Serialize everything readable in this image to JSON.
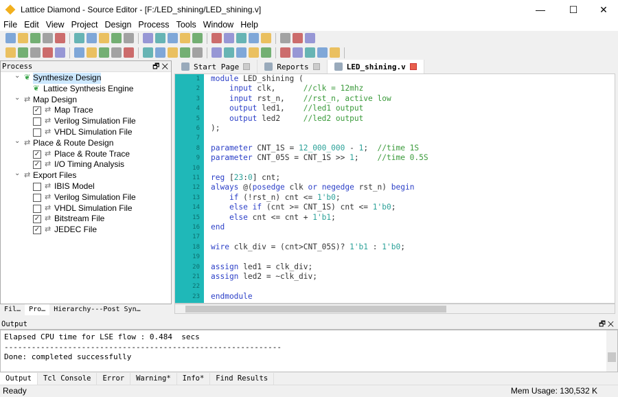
{
  "window": {
    "title": "Lattice Diamond - Source Editor - [F:/LED_shining/LED_shining.v]",
    "minimize": "—",
    "maximize": "☐",
    "close": "✕"
  },
  "menu": [
    "File",
    "Edit",
    "View",
    "Project",
    "Design",
    "Process",
    "Tools",
    "Window",
    "Help"
  ],
  "process_panel": {
    "title": "Process",
    "controls": "🗗 ✕",
    "items": [
      {
        "label": "Synthesize Design",
        "level": 0,
        "expand": true,
        "icon": "synthesis-icon",
        "selected": true
      },
      {
        "label": "Lattice Synthesis Engine",
        "level": 1,
        "icon": "synthesis-icon"
      },
      {
        "label": "Map Design",
        "level": 0,
        "expand": true,
        "icon": "process-icon"
      },
      {
        "label": "Map Trace",
        "level": 1,
        "checked": true,
        "icon": "process-icon"
      },
      {
        "label": "Verilog Simulation File",
        "level": 1,
        "checked": false,
        "icon": "process-icon"
      },
      {
        "label": "VHDL Simulation File",
        "level": 1,
        "checked": false,
        "icon": "process-icon"
      },
      {
        "label": "Place & Route Design",
        "level": 0,
        "expand": true,
        "icon": "process-icon"
      },
      {
        "label": "Place & Route Trace",
        "level": 1,
        "checked": true,
        "icon": "process-icon"
      },
      {
        "label": "I/O Timing Analysis",
        "level": 1,
        "checked": true,
        "icon": "process-icon"
      },
      {
        "label": "Export Files",
        "level": 0,
        "expand": true,
        "icon": "process-icon"
      },
      {
        "label": "IBIS Model",
        "level": 1,
        "checked": false,
        "icon": "process-icon"
      },
      {
        "label": "Verilog Simulation File",
        "level": 1,
        "checked": false,
        "icon": "process-icon"
      },
      {
        "label": "VHDL Simulation File",
        "level": 1,
        "checked": false,
        "icon": "process-icon"
      },
      {
        "label": "Bitstream File",
        "level": 1,
        "checked": true,
        "icon": "process-icon"
      },
      {
        "label": "JEDEC File",
        "level": 1,
        "checked": true,
        "icon": "process-icon"
      }
    ],
    "tabs": [
      {
        "label": "Fil…"
      },
      {
        "label": "Pro…",
        "active": true
      },
      {
        "label": "Hierarchy---Post Syn…"
      }
    ]
  },
  "editor": {
    "tabs": [
      {
        "label": "Start Page"
      },
      {
        "label": "Reports"
      },
      {
        "label": "LED_shining.v",
        "active": true
      }
    ],
    "gutter_color": "#1fb8b8",
    "lines": [
      [
        [
          "k",
          "module"
        ],
        [
          "p",
          " LED_shining ("
        ]
      ],
      [
        [
          "p",
          "    "
        ],
        [
          "k",
          "input"
        ],
        [
          "p",
          " clk,      "
        ],
        [
          "c",
          "//clk = 12mhz"
        ]
      ],
      [
        [
          "p",
          "    "
        ],
        [
          "k",
          "input"
        ],
        [
          "p",
          " rst_n,    "
        ],
        [
          "c",
          "//rst_n, active low"
        ]
      ],
      [
        [
          "p",
          "    "
        ],
        [
          "k",
          "output"
        ],
        [
          "p",
          " led1,    "
        ],
        [
          "c",
          "//led1 output"
        ]
      ],
      [
        [
          "p",
          "    "
        ],
        [
          "k",
          "output"
        ],
        [
          "p",
          " led2     "
        ],
        [
          "c",
          "//led2 output"
        ]
      ],
      [
        [
          "p",
          ");"
        ]
      ],
      [],
      [
        [
          "k",
          "parameter"
        ],
        [
          "p",
          " CNT_1S = "
        ],
        [
          "n",
          "12_000_000"
        ],
        [
          "p",
          " - "
        ],
        [
          "n",
          "1"
        ],
        [
          "p",
          ";  "
        ],
        [
          "c",
          "//time 1S"
        ]
      ],
      [
        [
          "k",
          "parameter"
        ],
        [
          "p",
          " CNT_05S = CNT_1S >> "
        ],
        [
          "n",
          "1"
        ],
        [
          "p",
          ";    "
        ],
        [
          "c",
          "//time 0.5S"
        ]
      ],
      [],
      [
        [
          "k",
          "reg"
        ],
        [
          "p",
          " ["
        ],
        [
          "n",
          "23"
        ],
        [
          "p",
          ":"
        ],
        [
          "n",
          "0"
        ],
        [
          "p",
          "] cnt;"
        ]
      ],
      [
        [
          "k",
          "always"
        ],
        [
          "p",
          " @("
        ],
        [
          "k",
          "posedge"
        ],
        [
          "p",
          " clk "
        ],
        [
          "k",
          "or"
        ],
        [
          "p",
          " "
        ],
        [
          "k",
          "negedge"
        ],
        [
          "p",
          " rst_n) "
        ],
        [
          "k",
          "begin"
        ]
      ],
      [
        [
          "p",
          "    "
        ],
        [
          "k",
          "if"
        ],
        [
          "p",
          " (!rst_n) cnt <= "
        ],
        [
          "n",
          "1'b0"
        ],
        [
          "p",
          ";"
        ]
      ],
      [
        [
          "p",
          "    "
        ],
        [
          "k",
          "else if"
        ],
        [
          "p",
          " (cnt >= CNT_1S) cnt <= "
        ],
        [
          "n",
          "1'b0"
        ],
        [
          "p",
          ";"
        ]
      ],
      [
        [
          "p",
          "    "
        ],
        [
          "k",
          "else"
        ],
        [
          "p",
          " cnt <= cnt + "
        ],
        [
          "n",
          "1'b1"
        ],
        [
          "p",
          ";"
        ]
      ],
      [
        [
          "k",
          "end"
        ]
      ],
      [],
      [
        [
          "k",
          "wire"
        ],
        [
          "p",
          " clk_div = (cnt>CNT_05S)? "
        ],
        [
          "n",
          "1'b1"
        ],
        [
          "p",
          " : "
        ],
        [
          "n",
          "1'b0"
        ],
        [
          "p",
          ";"
        ]
      ],
      [],
      [
        [
          "k",
          "assign"
        ],
        [
          "p",
          " led1 = clk_div;"
        ]
      ],
      [
        [
          "k",
          "assign"
        ],
        [
          "p",
          " led2 = ~clk_div;"
        ]
      ],
      [],
      [
        [
          "k",
          "endmodule"
        ]
      ]
    ]
  },
  "output": {
    "title": "Output",
    "controls": "🗗 ✕",
    "text": "Elapsed CPU time for LSE flow : 0.484  secs\n-------------------------------------------------------------\nDone: completed successfully",
    "tabs": [
      {
        "label": "Output",
        "active": true
      },
      {
        "label": "Tcl Console"
      },
      {
        "label": "Error"
      },
      {
        "label": "Warning*"
      },
      {
        "label": "Info*"
      },
      {
        "label": "Find Results"
      }
    ]
  },
  "status": {
    "text": "Ready",
    "mem": "Mem Usage: 130,532 K"
  }
}
